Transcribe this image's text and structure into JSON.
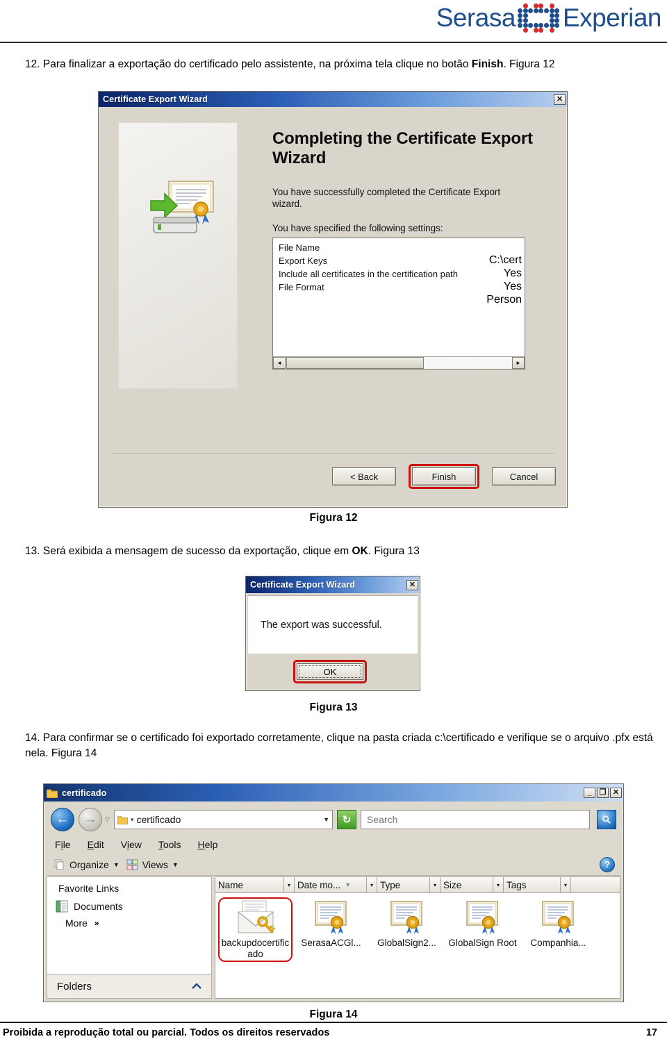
{
  "brand": {
    "name_left": "Serasa",
    "name_right": "Experian",
    "color_blue": "#1f4e8c",
    "color_red": "#d42b2b"
  },
  "steps": [
    {
      "number": "12.",
      "text_before": "Para finalizar a exportação do certificado pelo assistente, na próxima tela clique no botão ",
      "bold": "Finish",
      "text_after": ". Figura 12"
    },
    {
      "number": "13.",
      "text_before": "Será exibida a mensagem de sucesso da exportação, clique em ",
      "bold": "OK",
      "text_after": ". Figura 13"
    },
    {
      "number": "14.",
      "text_before": "Para confirmar se o certificado foi exportado corretamente, clique na pasta criada c:\\certificado e verifique se o arquivo .pfx está nela.",
      "bold": "",
      "text_after": " Figura 14"
    }
  ],
  "captions": {
    "fig12": "Figura 12",
    "fig13": "Figura 13",
    "fig14": "Figura 14"
  },
  "wizard": {
    "title": "Certificate Export Wizard",
    "close_label": "✕",
    "heading": "Completing the Certificate Export Wizard",
    "paragraph": "You have successfully completed the Certificate Export wizard.",
    "settings_intro": "You have specified the following settings:",
    "settings": [
      {
        "key": "File Name",
        "value": "C:\\cert"
      },
      {
        "key": "Export Keys",
        "value": "Yes"
      },
      {
        "key": "Include all certificates in the certification path",
        "value": "Yes"
      },
      {
        "key": "File Format",
        "value": "Person"
      }
    ],
    "scroll_left": "◄",
    "scroll_right": "►",
    "buttons": {
      "back": "< Back",
      "finish": "Finish",
      "cancel": "Cancel"
    },
    "highlight_color": "#cc1111"
  },
  "msgbox": {
    "title": "Certificate Export Wizard",
    "close_label": "✕",
    "message": "The export was successful.",
    "ok_label": "OK",
    "highlight_color": "#cc1111"
  },
  "explorer": {
    "title": "certificado",
    "window_buttons": {
      "minimize": "_",
      "maximize": "❐",
      "close": "✕"
    },
    "nav": {
      "back": "←",
      "forward": "→",
      "history_caret": "▽"
    },
    "address": {
      "separator": "▾",
      "path": "certificado",
      "dropdown": "▼"
    },
    "refresh_label": "↻",
    "search": {
      "placeholder": "Search",
      "value": "",
      "go_label": "🔍"
    },
    "menus": [
      {
        "pre": "F",
        "accel": "i",
        "post": "le"
      },
      {
        "pre": "",
        "accel": "E",
        "post": "dit"
      },
      {
        "pre": "V",
        "accel": "i",
        "post": "ew"
      },
      {
        "pre": "",
        "accel": "T",
        "post": "ools"
      },
      {
        "pre": "",
        "accel": "H",
        "post": "elp"
      }
    ],
    "toolbar": {
      "organize": "Organize",
      "views": "Views",
      "caret": "▼",
      "help": "?"
    },
    "sidebar": {
      "favorites_title": "Favorite Links",
      "items": [
        {
          "label": "Documents"
        }
      ],
      "more_label": "More",
      "more_chevron": "»",
      "folders_label": "Folders",
      "folders_chevron": "︿"
    },
    "columns": [
      {
        "label": "Name",
        "sorted": false
      },
      {
        "label": "Date mo...",
        "sorted": true
      },
      {
        "label": "Type",
        "sorted": false
      },
      {
        "label": "Size",
        "sorted": false
      },
      {
        "label": "Tags",
        "sorted": false
      }
    ],
    "column_caret": "▾",
    "sort_caret": "▼",
    "files": [
      {
        "label": "backupdocertificado",
        "icon": "pfx-key-envelope-icon",
        "selected": true
      },
      {
        "label": "SerasaACGl...",
        "icon": "certificate-icon",
        "selected": false
      },
      {
        "label": "GlobalSign2...",
        "icon": "certificate-icon",
        "selected": false
      },
      {
        "label": "GlobalSign Root",
        "icon": "certificate-icon",
        "selected": false
      },
      {
        "label": "Companhia...",
        "icon": "certificate-icon",
        "selected": false
      }
    ]
  },
  "footer": {
    "text": "Proibida a reprodução total ou parcial. Todos os direitos reservados",
    "page": "17"
  }
}
